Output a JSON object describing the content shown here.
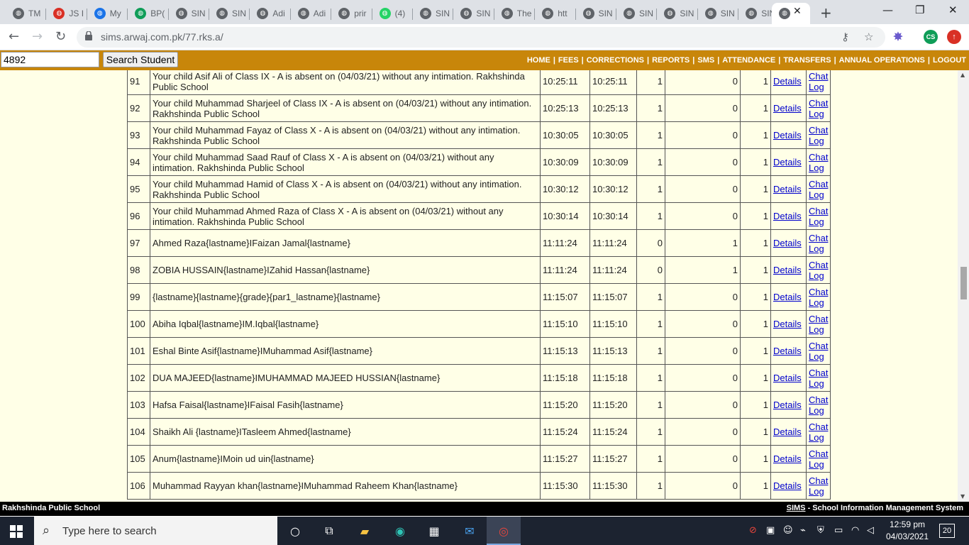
{
  "browser": {
    "tabs": [
      {
        "label": "TM",
        "color": "#5f6368",
        "icon": "globe-icon"
      },
      {
        "label": "JS I",
        "color": "#d93025",
        "icon": "gmail-icon"
      },
      {
        "label": "My",
        "color": "#1a73e8",
        "icon": "drive-icon"
      },
      {
        "label": "BP(",
        "color": "#0f9d58",
        "icon": "sheets-icon"
      },
      {
        "label": "SIN",
        "color": "#5f6368",
        "icon": "globe-icon"
      },
      {
        "label": "SIN",
        "color": "#5f6368",
        "icon": "globe-icon"
      },
      {
        "label": "Adi",
        "color": "#5f6368",
        "icon": "globe-icon"
      },
      {
        "label": "Adi",
        "color": "#5f6368",
        "icon": "globe-icon"
      },
      {
        "label": "prir",
        "color": "#5f6368",
        "icon": "globe-icon"
      },
      {
        "label": "(4)",
        "color": "#25d366",
        "icon": "whatsapp-icon"
      },
      {
        "label": "SIN",
        "color": "#5f6368",
        "icon": "globe-icon"
      },
      {
        "label": "SIN",
        "color": "#5f6368",
        "icon": "globe-icon"
      },
      {
        "label": "The",
        "color": "#5f6368",
        "icon": "globe-icon"
      },
      {
        "label": "htt",
        "color": "#5f6368",
        "icon": "globe-icon"
      },
      {
        "label": "SIN",
        "color": "#5f6368",
        "icon": "globe-icon"
      },
      {
        "label": "SIN",
        "color": "#5f6368",
        "icon": "globe-icon"
      },
      {
        "label": "SIN",
        "color": "#5f6368",
        "icon": "globe-icon"
      },
      {
        "label": "SIN",
        "color": "#5f6368",
        "icon": "globe-icon"
      },
      {
        "label": "SIN",
        "color": "#5f6368",
        "icon": "globe-icon"
      }
    ],
    "url": "sims.arwaj.com.pk/77.rks.a/",
    "profile_initials": "CS"
  },
  "site": {
    "student_id_value": "4892",
    "search_button": "Search Student",
    "nav": [
      "HOME",
      "FEES",
      "CORRECTIONS",
      "REPORTS",
      "SMS",
      "ATTENDANCE",
      "TRANSFERS",
      "ANNUAL OPERATIONS",
      "LOGOUT"
    ],
    "details_label": "Details",
    "chat_label": "Chat Log",
    "footer_left": "Rakhshinda Public School",
    "footer_sims": "SIMS",
    "footer_right": " - School Information Management System"
  },
  "rows": [
    {
      "num": "91",
      "msg": "Your child Asif Ali of Class IX - A is absent on (04/03/21) without any intimation. Rakhshinda Public School",
      "t1": "10:25:11",
      "t2": "10:25:11",
      "a": "1",
      "b": "0",
      "c": "1"
    },
    {
      "num": "92",
      "msg": "Your child Muhammad Sharjeel of Class IX - A is absent on (04/03/21) without any intimation. Rakhshinda Public School",
      "t1": "10:25:13",
      "t2": "10:25:13",
      "a": "1",
      "b": "0",
      "c": "1"
    },
    {
      "num": "93",
      "msg": "Your child Muhammad Fayaz of Class X - A is absent on (04/03/21) without any intimation. Rakhshinda Public School",
      "t1": "10:30:05",
      "t2": "10:30:05",
      "a": "1",
      "b": "0",
      "c": "1"
    },
    {
      "num": "94",
      "msg": "Your child Muhammad Saad Rauf of Class X - A is absent on (04/03/21) without any intimation. Rakhshinda Public School",
      "t1": "10:30:09",
      "t2": "10:30:09",
      "a": "1",
      "b": "0",
      "c": "1"
    },
    {
      "num": "95",
      "msg": "Your child Muhammad Hamid of Class X - A is absent on (04/03/21) without any intimation. Rakhshinda Public School",
      "t1": "10:30:12",
      "t2": "10:30:12",
      "a": "1",
      "b": "0",
      "c": "1"
    },
    {
      "num": "96",
      "msg": "Your child Muhammad Ahmed Raza of Class X - A is absent on (04/03/21) without any intimation. Rakhshinda Public School",
      "t1": "10:30:14",
      "t2": "10:30:14",
      "a": "1",
      "b": "0",
      "c": "1"
    },
    {
      "num": "97",
      "msg": "Ahmed Raza{lastname}IFaizan Jamal{lastname}",
      "t1": "11:11:24",
      "t2": "11:11:24",
      "a": "0",
      "b": "1",
      "c": "1"
    },
    {
      "num": "98",
      "msg": "ZOBIA HUSSAIN{lastname}IZahid Hassan{lastname}",
      "t1": "11:11:24",
      "t2": "11:11:24",
      "a": "0",
      "b": "1",
      "c": "1"
    },
    {
      "num": "99",
      "msg": "{lastname}{lastname}{grade}{par1_lastname}{lastname}",
      "t1": "11:15:07",
      "t2": "11:15:07",
      "a": "1",
      "b": "0",
      "c": "1"
    },
    {
      "num": "100",
      "msg": "Abiha Iqbal{lastname}IM.Iqbal{lastname}",
      "t1": "11:15:10",
      "t2": "11:15:10",
      "a": "1",
      "b": "0",
      "c": "1"
    },
    {
      "num": "101",
      "msg": "Eshal Binte Asif{lastname}IMuhammad Asif{lastname}",
      "t1": "11:15:13",
      "t2": "11:15:13",
      "a": "1",
      "b": "0",
      "c": "1"
    },
    {
      "num": "102",
      "msg": "DUA MAJEED{lastname}IMUHAMMAD MAJEED HUSSIAN{lastname}",
      "t1": "11:15:18",
      "t2": "11:15:18",
      "a": "1",
      "b": "0",
      "c": "1"
    },
    {
      "num": "103",
      "msg": "Hafsa Faisal{lastname}IFaisal Fasih{lastname}",
      "t1": "11:15:20",
      "t2": "11:15:20",
      "a": "1",
      "b": "0",
      "c": "1"
    },
    {
      "num": "104",
      "msg": "Shaikh Ali {lastname}ITasleem Ahmed{lastname}",
      "t1": "11:15:24",
      "t2": "11:15:24",
      "a": "1",
      "b": "0",
      "c": "1"
    },
    {
      "num": "105",
      "msg": "Anum{lastname}IMoin ud uin{lastname}",
      "t1": "11:15:27",
      "t2": "11:15:27",
      "a": "1",
      "b": "0",
      "c": "1"
    },
    {
      "num": "106",
      "msg": "Muhammad Rayyan khan{lastname}IMuhammad Raheem Khan{lastname}",
      "t1": "11:15:30",
      "t2": "11:15:30",
      "a": "1",
      "b": "0",
      "c": "1"
    }
  ],
  "taskbar": {
    "search_placeholder": "Type here to search",
    "time": "12:59 pm",
    "date": "04/03/2021",
    "notifications": "20"
  }
}
